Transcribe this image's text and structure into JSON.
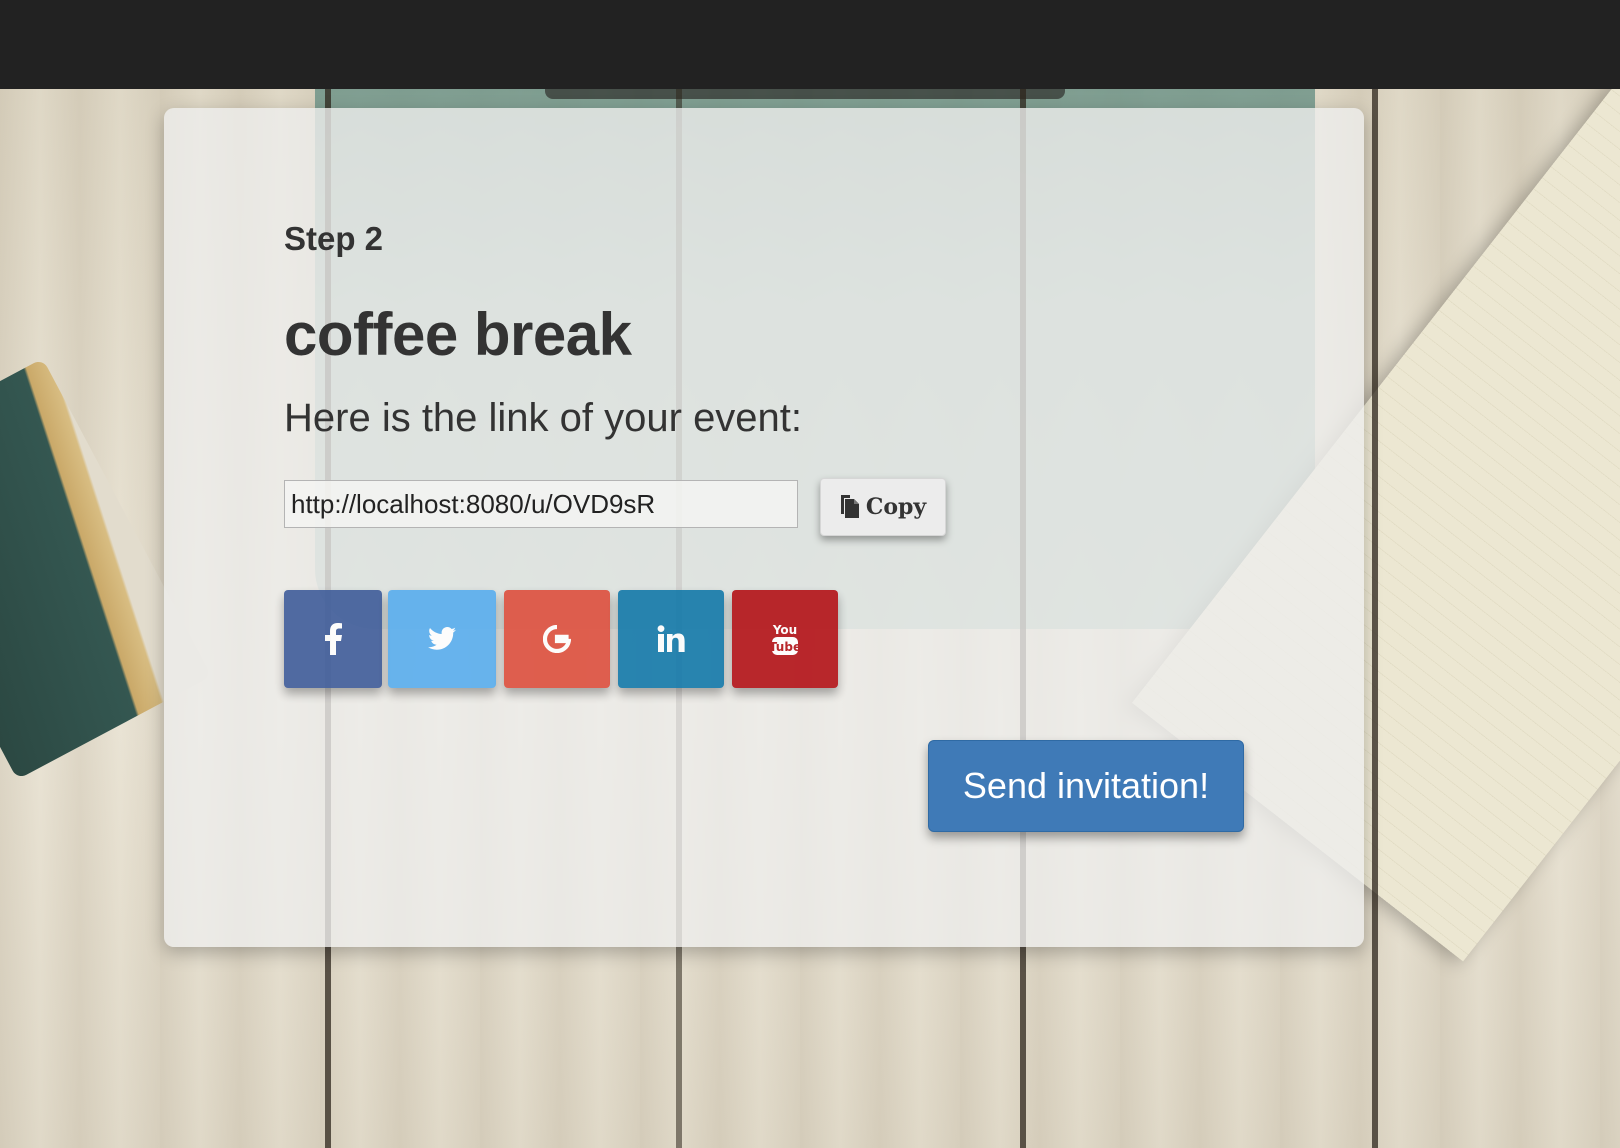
{
  "step": {
    "label": "Step 2"
  },
  "event": {
    "title": "coffee break"
  },
  "link_section": {
    "label": "Here is the link of your event:",
    "url": "http://localhost:8080/u/OVD9sR",
    "copy_label": "Copy",
    "copy_icon": "clipboard-icon"
  },
  "social": [
    {
      "network": "facebook",
      "icon": "facebook-icon",
      "color": "#3b5998"
    },
    {
      "network": "twitter",
      "icon": "twitter-icon",
      "color": "#55acee"
    },
    {
      "network": "google",
      "icon": "google-icon",
      "color": "#dd4b39"
    },
    {
      "network": "linkedin",
      "icon": "linkedin-icon",
      "color": "#0e76a8"
    },
    {
      "network": "youtube",
      "icon": "youtube-icon",
      "color": "#b31217",
      "icon_text_top": "You",
      "icon_text_bottom": "Tube"
    }
  ],
  "actions": {
    "send_label": "Send invitation!"
  },
  "colors": {
    "topbar": "#222222",
    "primary_button": "#3f7ab7",
    "text": "#333333"
  }
}
